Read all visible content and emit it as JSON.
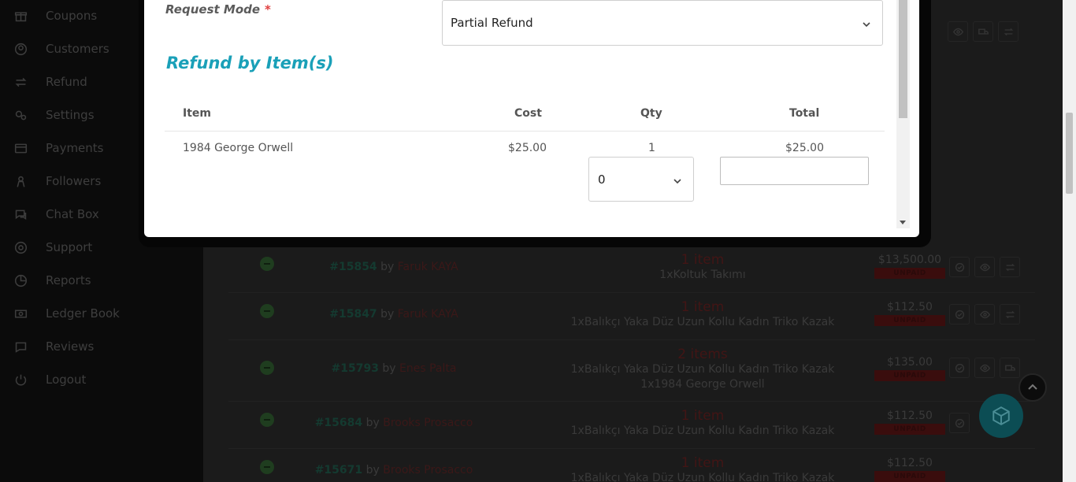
{
  "sidebar": {
    "items": [
      {
        "label": "Coupons",
        "icon": "gift-icon"
      },
      {
        "label": "Customers",
        "icon": "user-circle-icon"
      },
      {
        "label": "Refund",
        "icon": "refund-arrows-icon"
      },
      {
        "label": "Settings",
        "icon": "gears-icon"
      },
      {
        "label": "Payments",
        "icon": "credit-card-icon"
      },
      {
        "label": "Followers",
        "icon": "followers-icon"
      },
      {
        "label": "Chat Box",
        "icon": "chat-icon"
      },
      {
        "label": "Support",
        "icon": "lifebuoy-icon"
      },
      {
        "label": "Reports",
        "icon": "pie-chart-icon"
      },
      {
        "label": "Ledger Book",
        "icon": "money-icon"
      },
      {
        "label": "Reviews",
        "icon": "comment-icon"
      },
      {
        "label": "Logout",
        "icon": "power-icon"
      }
    ]
  },
  "orders": [
    {
      "number": "#15854",
      "by": "by",
      "customer": "Faruk KAYA",
      "count": "1 item",
      "products": [
        "1xKoltuk Takımı"
      ],
      "amount": "$13,500.00",
      "status": "UNPAID"
    },
    {
      "number": "#15847",
      "by": "by",
      "customer": "Faruk KAYA",
      "count": "1 item",
      "products": [
        "1xBalıkçı Yaka Düz Uzun Kollu Kadın Triko Kazak"
      ],
      "amount": "$112.50",
      "status": "UNPAID"
    },
    {
      "number": "#15793",
      "by": "by",
      "customer": "Enes Palta",
      "count": "2 items",
      "products": [
        "1xBalıkçı Yaka Düz Uzun Kollu Kadın Triko Kazak",
        "1x1984 George Orwell"
      ],
      "amount": "$135.00",
      "status": "UNPAID"
    },
    {
      "number": "#15684",
      "by": "by",
      "customer": "Brooks Prosacco",
      "count": "1 item",
      "products": [
        "1xBalıkçı Yaka Düz Uzun Kollu Kadın Triko Kazak"
      ],
      "amount": "$112.50",
      "status": "UNPAID"
    },
    {
      "number": "#15671",
      "by": "by",
      "customer": "Brooks Prosacco",
      "count": "1 item",
      "products": [
        "1xBalıkçı Yaka Düz Uzun Kollu Kadın Triko Kazak"
      ],
      "amount": "$112.50",
      "status": "UNPAID"
    }
  ],
  "modal": {
    "request_mode_label": "Request Mode",
    "required_mark": "*",
    "request_mode_value": "Partial Refund",
    "section_title": "Refund by Item(s)",
    "table": {
      "headers": {
        "item": "Item",
        "cost": "Cost",
        "qty": "Qty",
        "total": "Total"
      },
      "row": {
        "item": "1984 George Orwell",
        "cost": "$25.00",
        "qty": "1",
        "total": "$25.00"
      }
    },
    "refund_qty_value": "0",
    "refund_total_value": ""
  },
  "colors": {
    "accent": "#1aa0b8",
    "required": "#e03e3e",
    "unpaid_badge": "#3a0d0d"
  }
}
